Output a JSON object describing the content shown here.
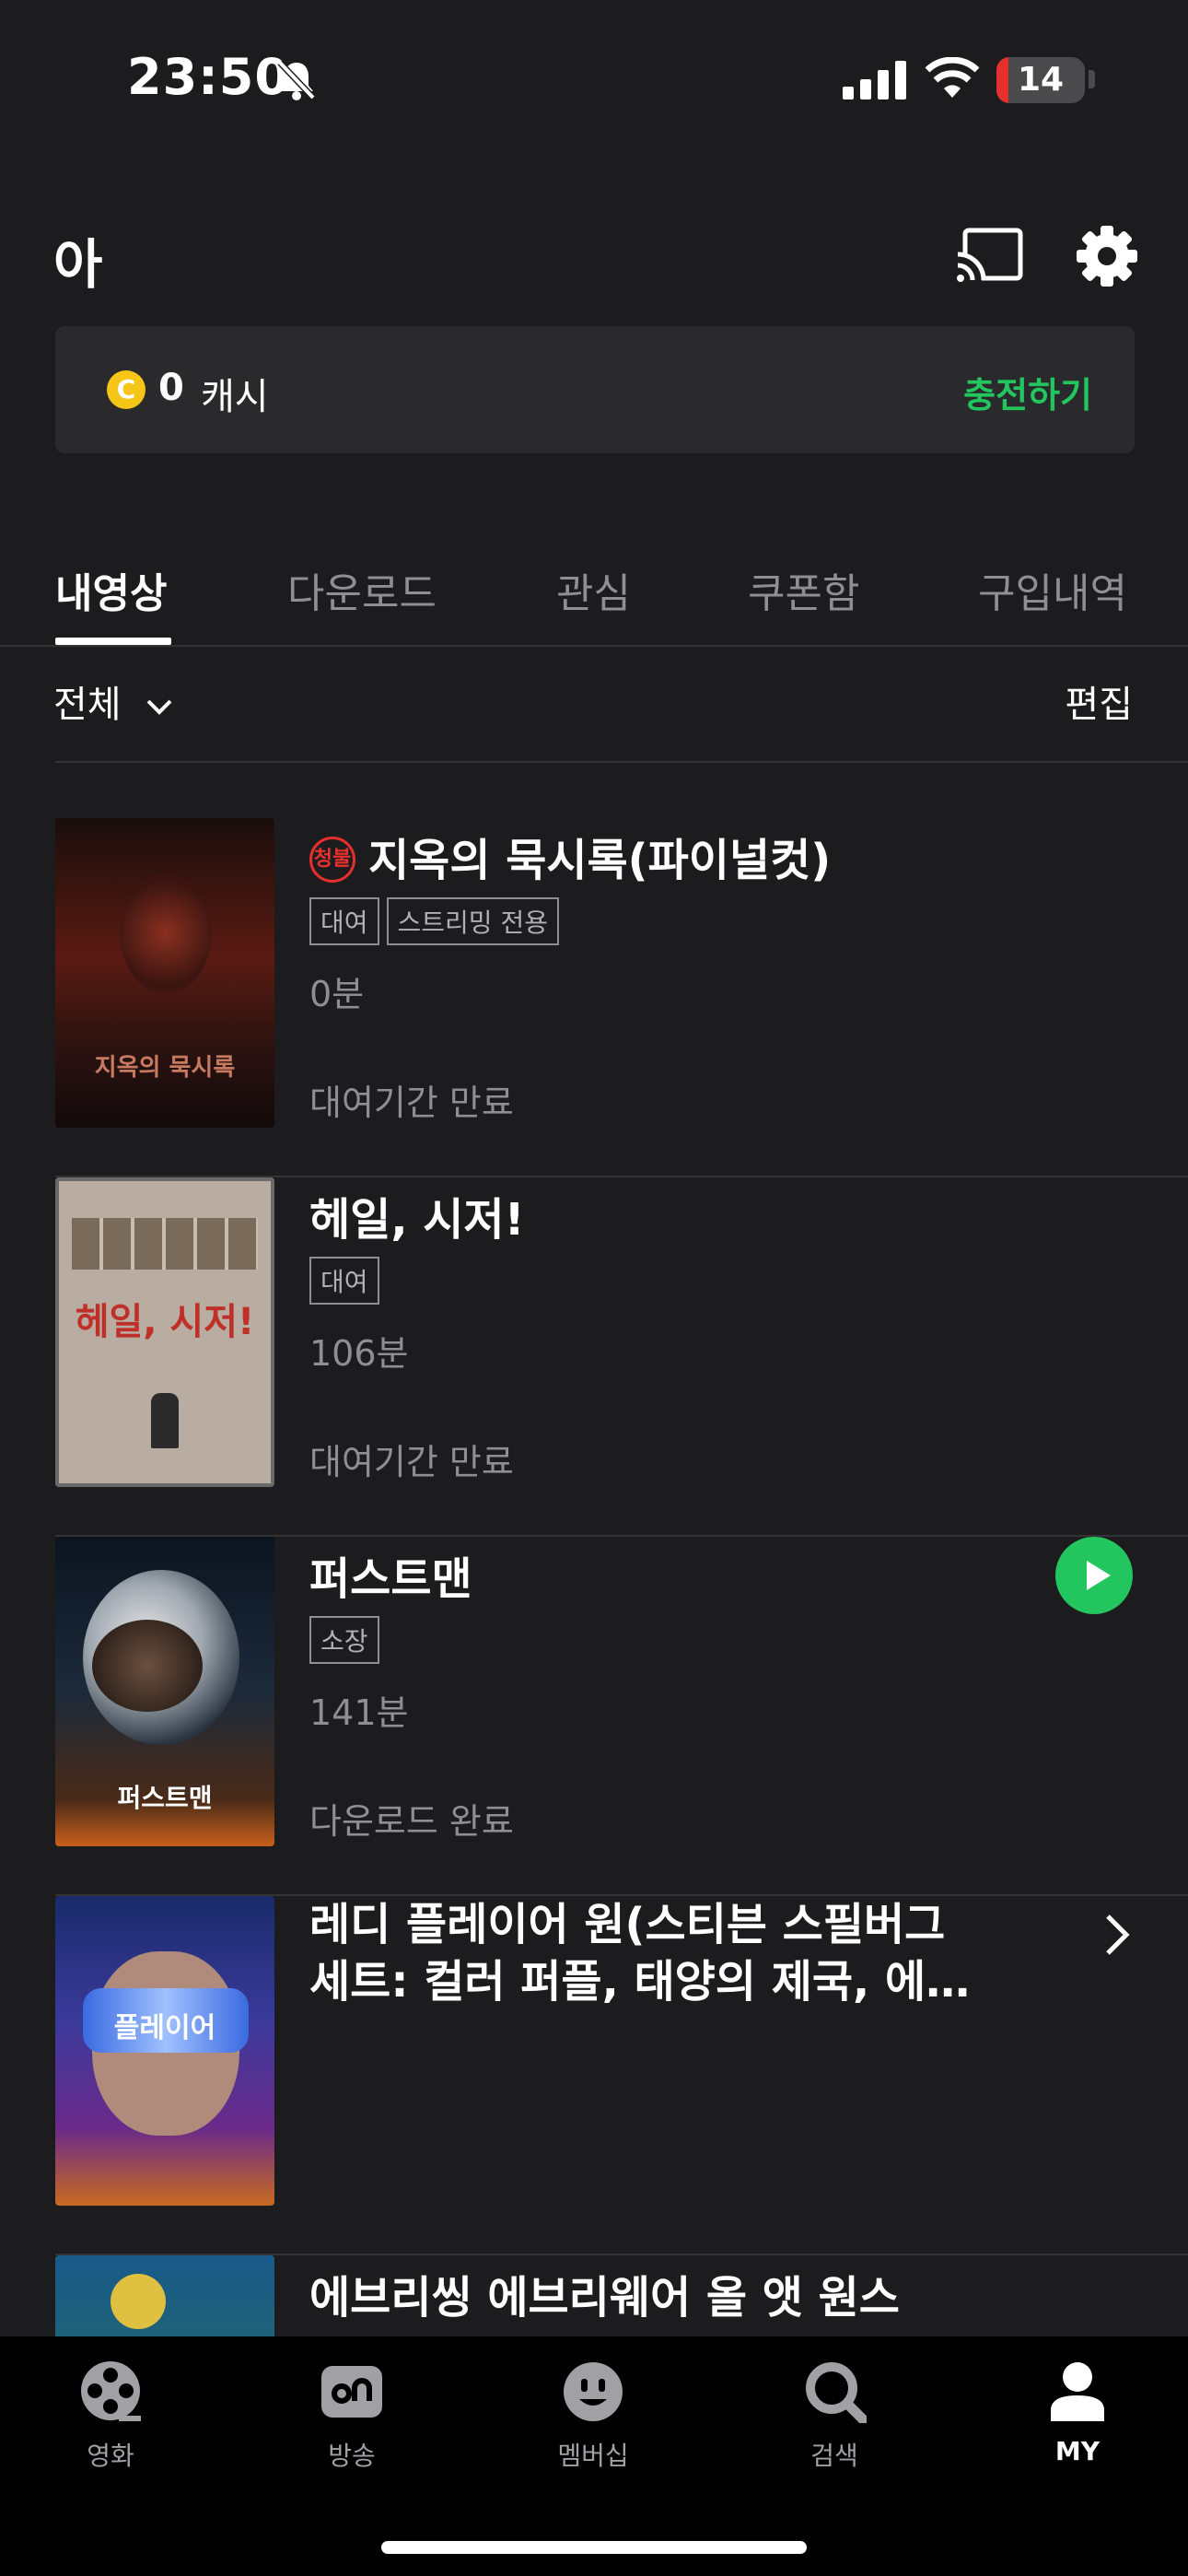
{
  "status_bar": {
    "time": "23:50",
    "battery": "14",
    "battery_level": 0.14
  },
  "header": {
    "profile_name": "아"
  },
  "cash": {
    "amount": "0",
    "unit": "캐시",
    "charge_label": "충전하기",
    "coin_symbol": "C"
  },
  "tabs": [
    {
      "label": "내영상",
      "active": true
    },
    {
      "label": "다운로드"
    },
    {
      "label": "관심"
    },
    {
      "label": "쿠폰함"
    },
    {
      "label": "구입내역"
    }
  ],
  "filter": {
    "label": "전체",
    "edit_label": "편집"
  },
  "items": [
    {
      "title": "지옥의 묵시록(파이널컷)",
      "age_badge": "청불",
      "badges": [
        "대여",
        "스트리밍 전용"
      ],
      "duration": "0분",
      "status": "대여기간 만료",
      "poster_text": "지옥의 묵시록",
      "poster_colors": [
        "#3a1410",
        "#1a1010"
      ]
    },
    {
      "title": "헤일, 시저!",
      "badges": [
        "대여"
      ],
      "duration": "106분",
      "status": "대여기간 만료",
      "poster_text": "헤일, 시저!",
      "poster_colors": [
        "#c9bfb3",
        "#a99f93"
      ]
    },
    {
      "title": "퍼스트맨",
      "badges": [
        "소장"
      ],
      "duration": "141분",
      "status": "다운로드 완료",
      "poster_text": "퍼스트맨",
      "poster_colors": [
        "#0e1a2a",
        "#6a3a20"
      ]
    },
    {
      "title": "레디 플레이어 원(스티븐 스필버그 세트: 컬러 퍼플, 태양의 제국, 에…",
      "poster_text": "플레이어",
      "poster_colors": [
        "#2a3a8a",
        "#6a2a8a"
      ]
    },
    {
      "title": "에브리씽 에브리웨어 올 앳 원스",
      "poster_colors": [
        "#1a5a8a",
        "#2a7a4a"
      ]
    }
  ],
  "bottom_nav": [
    {
      "label": "영화",
      "icon": "film-reel-icon"
    },
    {
      "label": "방송",
      "icon": "tv-on-icon"
    },
    {
      "label": "멤버십",
      "icon": "smile-icon"
    },
    {
      "label": "검색",
      "icon": "search-icon"
    },
    {
      "label": "MY",
      "icon": "person-icon",
      "active": true
    }
  ],
  "colors": {
    "accent": "#22c55e",
    "background": "#1c1c1e",
    "age_badge": "#e5302f"
  }
}
